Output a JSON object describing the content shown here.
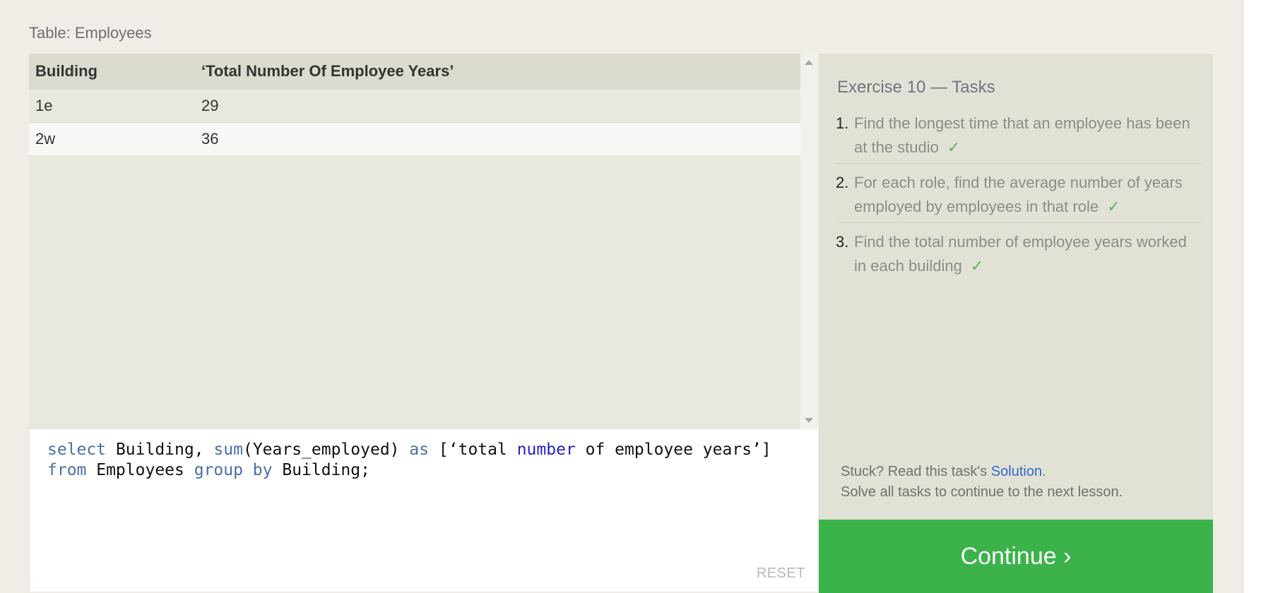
{
  "results": {
    "caption": "Table: Employees",
    "columns": [
      "Building",
      "‘Total Number Of Employee Years’"
    ],
    "rows": [
      [
        "1e",
        "29"
      ],
      [
        "2w",
        "36"
      ]
    ]
  },
  "editor": {
    "line1": {
      "select": "select",
      "p1": " Building, ",
      "sum": "sum",
      "p2": "(Years_employed) ",
      "as": "as",
      "p3": " [‘total ",
      "number": "number",
      "p4": " of employee years’]"
    },
    "line2": {
      "from": "from",
      "p1": " Employees ",
      "group_by": "group by",
      "p2": " Building;"
    },
    "reset_label": "RESET"
  },
  "tasks": {
    "title": "Exercise 10 — Tasks",
    "items": [
      {
        "number": "1.",
        "text": "Find the longest time that an employee has been at the studio",
        "check": "✓"
      },
      {
        "number": "2.",
        "text": "For each role, find the average number of years employed by employees in that role",
        "check": "✓"
      },
      {
        "number": "3.",
        "text": "Find the total number of employee years worked in each building",
        "check": "✓"
      }
    ],
    "stuck_prefix": "Stuck? Read this task's ",
    "solution_label": "Solution",
    "stuck_suffix": ".",
    "solve_note": "Solve all tasks to continue to the next lesson."
  },
  "continue_label": "Continue ›",
  "colors": {
    "accent_green": "#3bb24a",
    "check_green": "#58b95a",
    "link_blue": "#3169c9"
  }
}
